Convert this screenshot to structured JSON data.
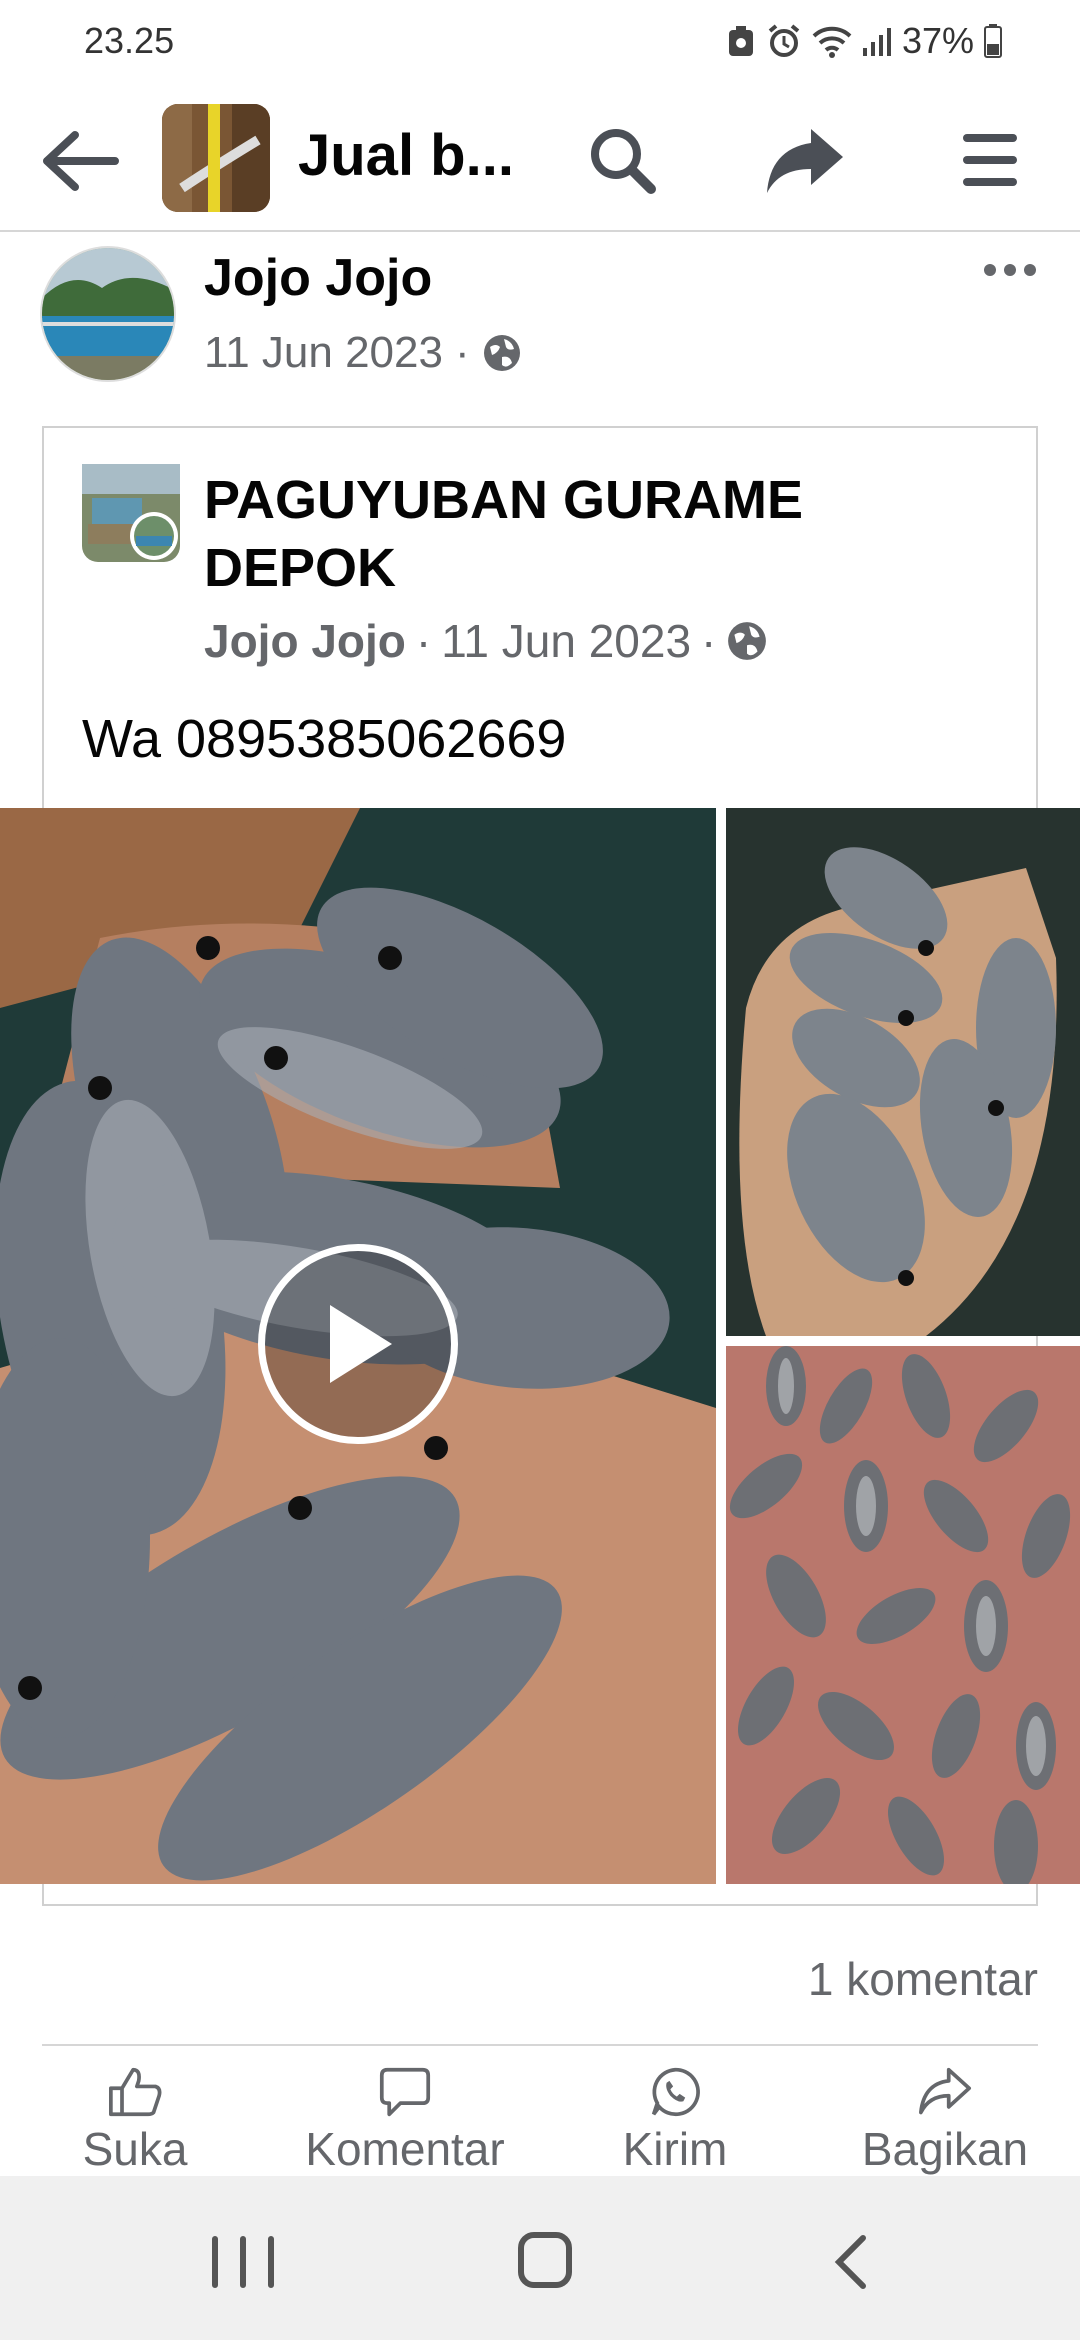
{
  "status_bar": {
    "time": "23.25",
    "battery": "37%"
  },
  "header": {
    "title": "Jual b...",
    "back_icon": "arrow-left-icon",
    "search_icon": "search-icon",
    "share_icon": "share-arrow-icon",
    "menu_icon": "hamburger-menu-icon"
  },
  "post": {
    "author": "Jojo Jojo",
    "date": "11 Jun 2023",
    "separator": "·",
    "privacy_icon": "globe-icon",
    "more_icon": "more-dots-icon",
    "shared": {
      "page_name": "PAGUYUBAN GURAME DEPOK",
      "author": "Jojo Jojo",
      "date": "11 Jun 2023",
      "text": "Wa 0895385062669"
    },
    "media": {
      "play_icon": "play-icon",
      "count": 3
    },
    "comments": "1 komentar"
  },
  "actions": {
    "like": "Suka",
    "comment": "Komentar",
    "send": "Kirim",
    "share": "Bagikan"
  },
  "colors": {
    "text": "#050505",
    "secondary": "#65676b",
    "divider": "#d6d6d6",
    "nav_bar": "#f0f0f0"
  }
}
